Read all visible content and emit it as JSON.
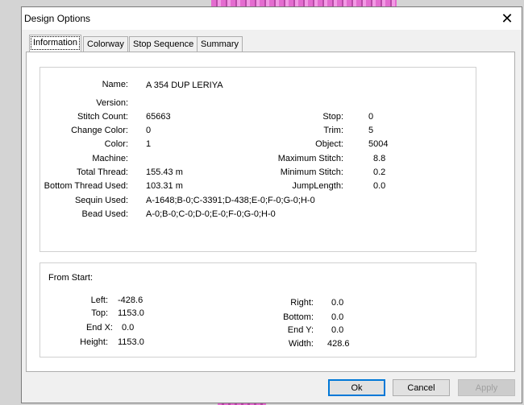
{
  "dialog": {
    "title": "Design Options",
    "close_glyph": "✕"
  },
  "tabs": [
    {
      "label": "Information"
    },
    {
      "label": "Colorway"
    },
    {
      "label": "Stop Sequence"
    },
    {
      "label": "Summary"
    }
  ],
  "info": {
    "name_label": "Name:",
    "name_value": "A 354 DUP LERIYA",
    "version_label": "Version:",
    "version_value": "",
    "stitch_count_label": "Stitch Count:",
    "stitch_count_value": "65663",
    "change_color_label": "Change Color:",
    "change_color_value": "0",
    "color_label": "Color:",
    "color_value": "1",
    "machine_label": "Machine:",
    "machine_value": "",
    "total_thread_label": "Total Thread:",
    "total_thread_value": "155.43 m",
    "bottom_thread_label": "Bottom Thread Used:",
    "bottom_thread_value": "103.31 m",
    "sequin_label": "Sequin Used:",
    "sequin_value": "A-1648;B-0;C-3391;D-438;E-0;F-0;G-0;H-0",
    "bead_label": "Bead Used:",
    "bead_value": "A-0;B-0;C-0;D-0;E-0;F-0;G-0;H-0",
    "stop_label": "Stop:",
    "stop_value": "0",
    "trim_label": "Trim:",
    "trim_value": "5",
    "object_label": "Object:",
    "object_value": "5004",
    "max_stitch_label": "Maximum Stitch:",
    "max_stitch_value": "8.8",
    "min_stitch_label": "Minimum Stitch:",
    "min_stitch_value": "0.2",
    "jump_length_label": "JumpLength:",
    "jump_length_value": "0.0"
  },
  "from_start": {
    "heading": "From Start:",
    "left_label": "Left:",
    "left_value": "-428.6",
    "top_label": "Top:",
    "top_value": "1153.0",
    "endx_label": "End X:",
    "endx_value": "0.0",
    "height_label": "Height:",
    "height_value": "1153.0",
    "right_label": "Right:",
    "right_value": "0.0",
    "bottom_label": "Bottom:",
    "bottom_value": "0.0",
    "endy_label": "End Y:",
    "endy_value": "0.0",
    "width_label": "Width:",
    "width_value": "428.6"
  },
  "buttons": {
    "ok": "Ok",
    "cancel": "Cancel",
    "apply": "Apply"
  }
}
